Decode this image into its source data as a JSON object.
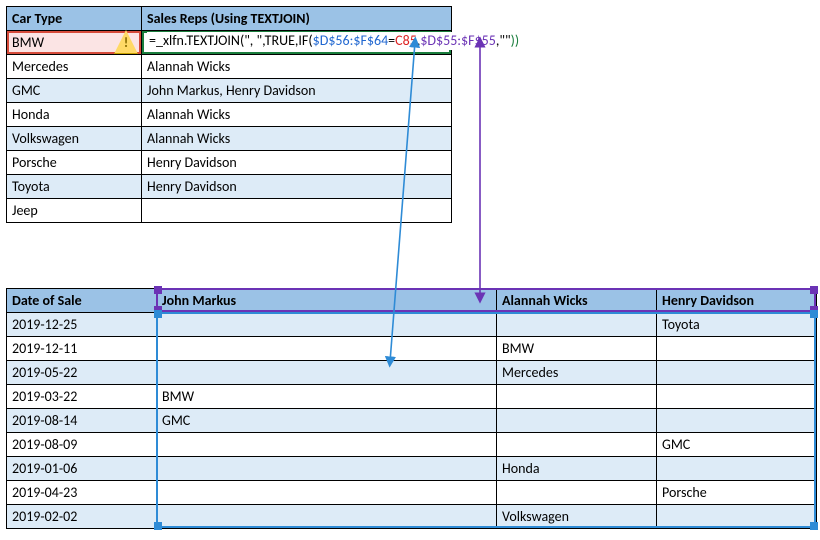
{
  "summary": {
    "headers": [
      "Car Type",
      "Sales Reps (Using TEXTJOIN)"
    ],
    "rows": [
      {
        "car": "BMW",
        "reps": ""
      },
      {
        "car": "Mercedes",
        "reps": "Alannah Wicks"
      },
      {
        "car": "GMC",
        "reps": "John Markus, Henry Davidson"
      },
      {
        "car": "Honda",
        "reps": "Alannah Wicks"
      },
      {
        "car": "Volkswagen",
        "reps": "Alannah Wicks"
      },
      {
        "car": "Porsche",
        "reps": "Henry Davidson"
      },
      {
        "car": "Toyota",
        "reps": "Henry Davidson"
      },
      {
        "car": "Jeep",
        "reps": ""
      }
    ]
  },
  "formula": {
    "p1": "=",
    "p2": "_xlfn.TEXTJOIN(\", \",TRUE,IF(",
    "ref_blue": "$D$56:$F$64",
    "eq": "=",
    "ref_red": "C85",
    "comma": ",",
    "ref_purple": "$D$55:$F$55",
    "tail": ",\"\"",
    "close": "))"
  },
  "sales": {
    "headers": [
      "Date of Sale",
      "John Markus",
      "Alannah Wicks",
      "Henry Davidson"
    ],
    "rows": [
      {
        "date": "2019-12-25",
        "jm": "",
        "aw": "",
        "hd": "Toyota"
      },
      {
        "date": "2019-12-11",
        "jm": "",
        "aw": "BMW",
        "hd": ""
      },
      {
        "date": "2019-05-22",
        "jm": "",
        "aw": "Mercedes",
        "hd": ""
      },
      {
        "date": "2019-03-22",
        "jm": "BMW",
        "aw": "",
        "hd": ""
      },
      {
        "date": "2019-08-14",
        "jm": "GMC",
        "aw": "",
        "hd": ""
      },
      {
        "date": "2019-08-09",
        "jm": "",
        "aw": "",
        "hd": "GMC"
      },
      {
        "date": "2019-01-06",
        "jm": "",
        "aw": "Honda",
        "hd": ""
      },
      {
        "date": "2019-04-23",
        "jm": "",
        "aw": "",
        "hd": "Porsche"
      },
      {
        "date": "2019-02-02",
        "jm": "",
        "aw": "Volkswagen",
        "hd": ""
      }
    ]
  },
  "colors": {
    "header_fill": "#9bc2e6",
    "zebra_light": "#ddebf7",
    "selected_cell": "#fbe4e4",
    "range_blue": "#2e8bd6",
    "range_purple": "#6b33b5",
    "formula_green": "#1a7e3d",
    "formula_red": "#d22"
  },
  "warning_icon_glyph": "!"
}
